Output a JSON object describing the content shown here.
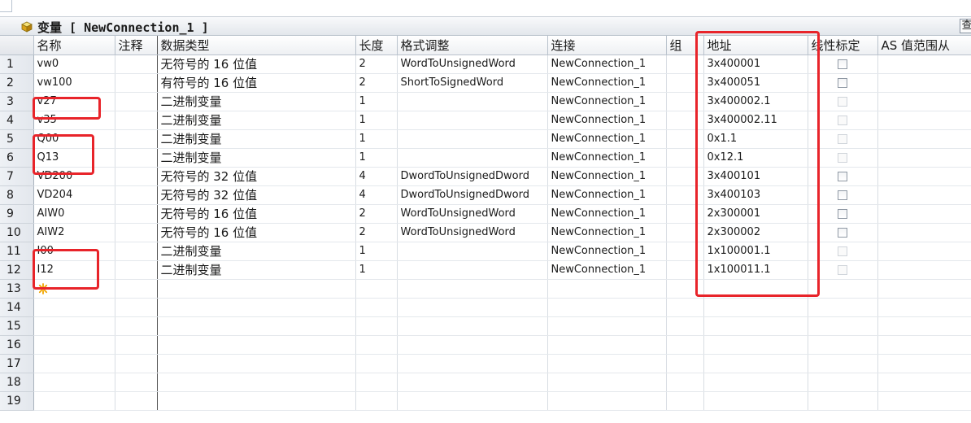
{
  "window": {
    "title": "变量 [ NewConnection_1 ]",
    "search_label": "查"
  },
  "columns": [
    "名称",
    "注释",
    "数据类型",
    "长度",
    "格式调整",
    "连接",
    "组",
    "地址",
    "线性标定",
    "AS 值范围从"
  ],
  "rows": [
    {
      "num": "1",
      "name": "vw0",
      "note": "",
      "type": "无符号的 16 位值",
      "length": "2",
      "format": "WordToUnsignedWord",
      "connection": "NewConnection_1",
      "group": "",
      "address": "3x400001",
      "linear": "enabled"
    },
    {
      "num": "2",
      "name": "vw100",
      "note": "",
      "type": "有符号的 16 位值",
      "length": "2",
      "format": "ShortToSignedWord",
      "connection": "NewConnection_1",
      "group": "",
      "address": "3x400051",
      "linear": "enabled"
    },
    {
      "num": "3",
      "name": "v27",
      "note": "",
      "type": "二进制变量",
      "length": "1",
      "format": "",
      "connection": "NewConnection_1",
      "group": "",
      "address": "3x400002.1",
      "linear": "disabled"
    },
    {
      "num": "4",
      "name": "v35",
      "note": "",
      "type": "二进制变量",
      "length": "1",
      "format": "",
      "connection": "NewConnection_1",
      "group": "",
      "address": "3x400002.11",
      "linear": "disabled"
    },
    {
      "num": "5",
      "name": "Q00",
      "note": "",
      "type": "二进制变量",
      "length": "1",
      "format": "",
      "connection": "NewConnection_1",
      "group": "",
      "address": "0x1.1",
      "linear": "disabled"
    },
    {
      "num": "6",
      "name": "Q13",
      "note": "",
      "type": "二进制变量",
      "length": "1",
      "format": "",
      "connection": "NewConnection_1",
      "group": "",
      "address": "0x12.1",
      "linear": "disabled"
    },
    {
      "num": "7",
      "name": "VD200",
      "note": "",
      "type": "无符号的 32 位值",
      "length": "4",
      "format": "DwordToUnsignedDword",
      "connection": "NewConnection_1",
      "group": "",
      "address": "3x400101",
      "linear": "enabled"
    },
    {
      "num": "8",
      "name": "VD204",
      "note": "",
      "type": "无符号的 32 位值",
      "length": "4",
      "format": "DwordToUnsignedDword",
      "connection": "NewConnection_1",
      "group": "",
      "address": "3x400103",
      "linear": "enabled"
    },
    {
      "num": "9",
      "name": "AIW0",
      "note": "",
      "type": "无符号的 16 位值",
      "length": "2",
      "format": "WordToUnsignedWord",
      "connection": "NewConnection_1",
      "group": "",
      "address": "2x300001",
      "linear": "enabled"
    },
    {
      "num": "10",
      "name": "AIW2",
      "note": "",
      "type": "无符号的 16 位值",
      "length": "2",
      "format": "WordToUnsignedWord",
      "connection": "NewConnection_1",
      "group": "",
      "address": "2x300002",
      "linear": "enabled"
    },
    {
      "num": "11",
      "name": "I00",
      "note": "",
      "type": "二进制变量",
      "length": "1",
      "format": "",
      "connection": "NewConnection_1",
      "group": "",
      "address": "1x100001.1",
      "linear": "disabled"
    },
    {
      "num": "12",
      "name": "I12",
      "note": "",
      "type": "二进制变量",
      "length": "1",
      "format": "",
      "connection": "NewConnection_1",
      "group": "",
      "address": "1x100011.1",
      "linear": "disabled"
    }
  ],
  "new_row_num": "13",
  "empty_rows": [
    "14",
    "15",
    "16",
    "17",
    "18",
    "19"
  ],
  "colors": {
    "highlight": "#e8242a",
    "grid_line": "#d8dde3",
    "header_bg": "#eef0f3"
  },
  "icons": {
    "title": "yellow-cube-icon",
    "new_row": "new-entry-sparkle-icon",
    "search": "search-button-icon"
  }
}
